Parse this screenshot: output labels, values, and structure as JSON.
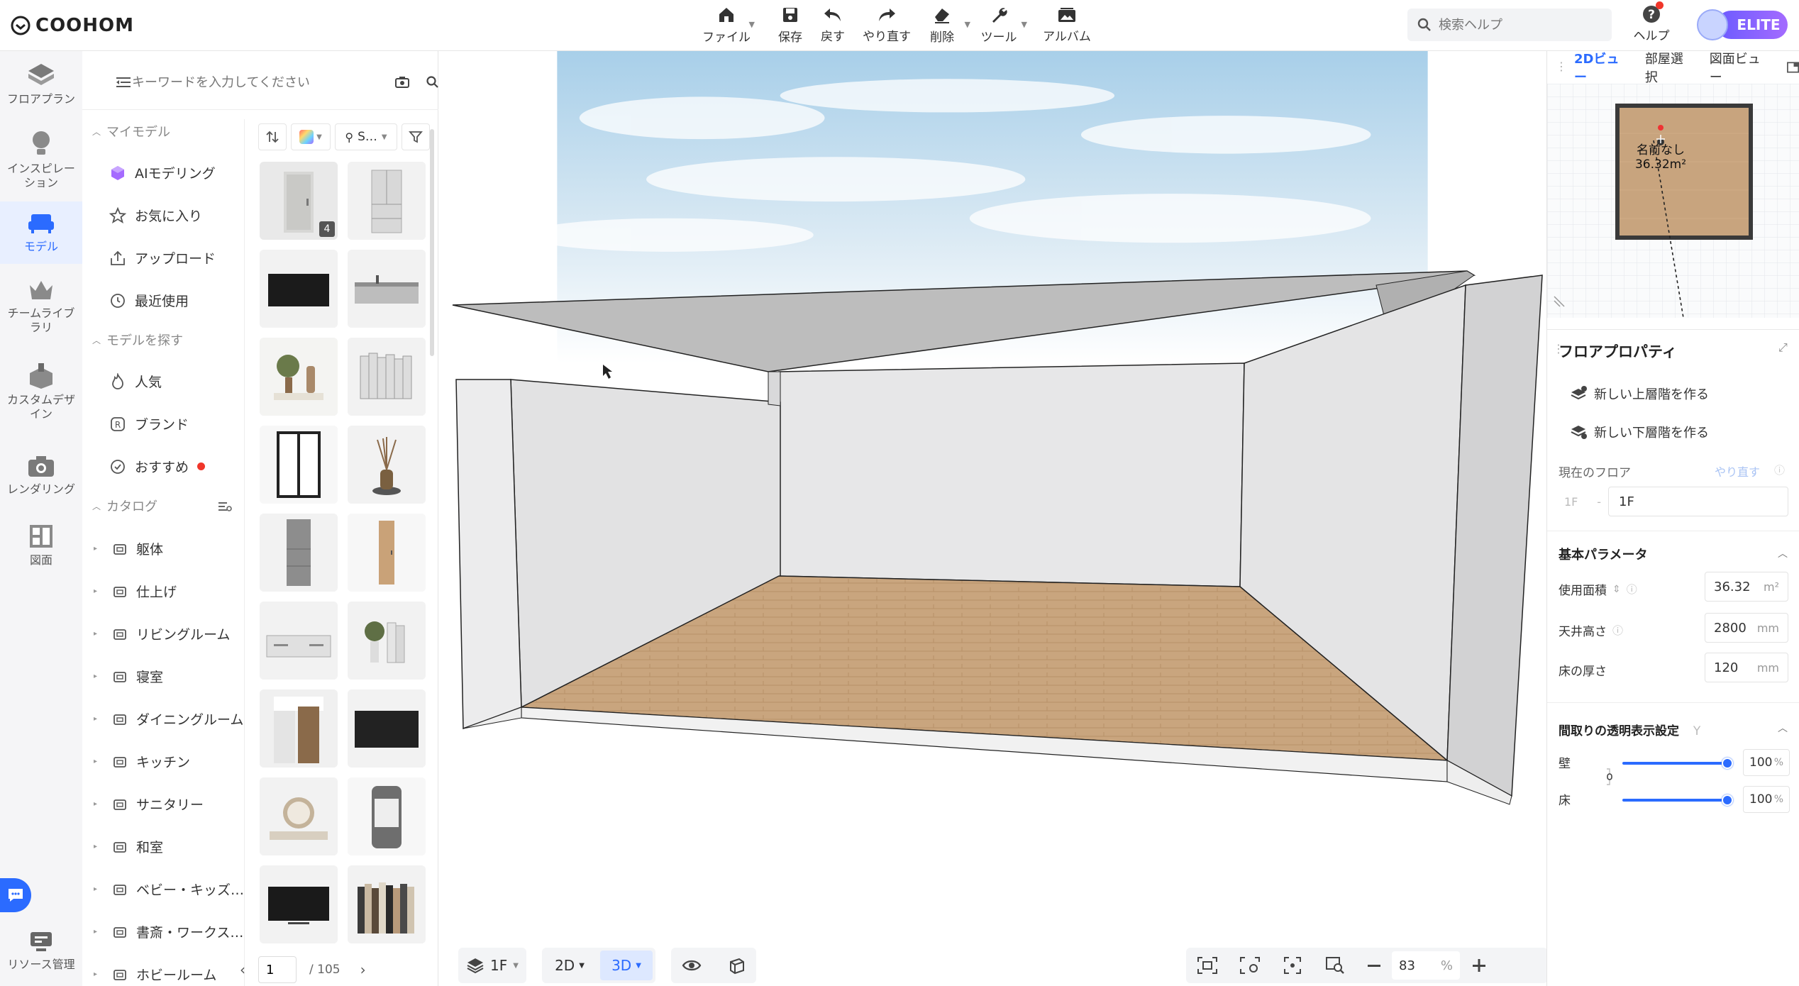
{
  "app": {
    "brand": "COOHOM"
  },
  "toolbar": {
    "file": "ファイル",
    "save": "保存",
    "undo": "戻す",
    "redo": "やり直す",
    "delete": "削除",
    "tools": "ツール",
    "album": "アルバム"
  },
  "search": {
    "placeholder": "検索ヘルプ"
  },
  "help": {
    "label": "ヘルプ"
  },
  "account": {
    "plan": "ELITE"
  },
  "rail": {
    "floorplan": "フロアプラン",
    "inspiration": "インスピレーション",
    "model": "モデル",
    "team_library": "チームライブラリ",
    "custom_design": "カスタムデザイン",
    "rendering": "レンダリング",
    "drawing": "図面",
    "resources": "リソース管理"
  },
  "panel": {
    "keyword_placeholder": "キーワードを入力してください",
    "my_models": "マイモデル",
    "ai_modeling": "AIモデリング",
    "favorites": "お気に入り",
    "upload": "アップロード",
    "recent": "最近使用",
    "find_models": "モデルを探す",
    "popular": "人気",
    "brand": "ブランド",
    "recommended": "おすすめ",
    "catalog": "カタログ",
    "categories": [
      "躯体",
      "仕上げ",
      "リビングルーム",
      "寝室",
      "ダイニングルーム",
      "キッチン",
      "サニタリー",
      "和室",
      "ベビー・キッズ…",
      "書斎・ワークス…",
      "ホビールーム"
    ],
    "style_filter": "S…",
    "thumb_badge": "4",
    "page_current": "1",
    "page_total": "/ 105"
  },
  "viewport": {
    "floor": "1F",
    "mode_2d": "2D",
    "mode_3d": "3D",
    "zoom_value": "83",
    "zoom_unit": "%"
  },
  "right": {
    "tab_2d": "2Dビュー",
    "tab_room": "部屋選択",
    "tab_drawing": "図面ビュー",
    "room_name": "名前なし",
    "room_area": "36.32m²",
    "props_title": "フロアプロパティ",
    "new_upper": "新しい上層階を作る",
    "new_lower": "新しい下層階を作る",
    "current_floor": "現在のフロア",
    "redo": "やり直す",
    "floor_small": "1F",
    "floor_value": "1F",
    "basic_params": "基本パラメータ",
    "area_label": "使用面積",
    "area_value": "36.32",
    "area_unit": "m²",
    "ceiling_label": "天井高さ",
    "ceiling_value": "2800",
    "ceiling_unit": "mm",
    "floor_thick_label": "床の厚さ",
    "floor_thick_value": "120",
    "floor_thick_unit": "mm",
    "transparency_title": "間取りの透明表示設定",
    "transparency_hint": "Y",
    "wall_label": "壁",
    "wall_value": "100",
    "floor_label": "床",
    "floor_opacity_value": "100",
    "pct": "%"
  },
  "colors": {
    "accent": "#2b6bff",
    "floor_wood": "#c9a57e",
    "wall": "#e9e9ea",
    "ceiling": "#bdbdbe"
  }
}
